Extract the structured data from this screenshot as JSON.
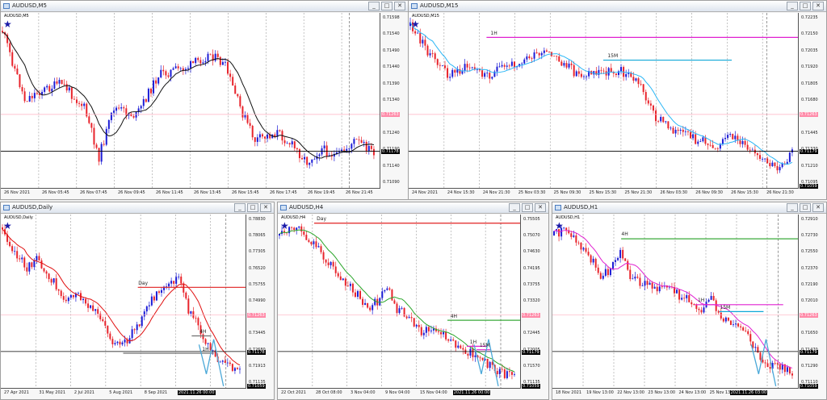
{
  "colors": {
    "bull": "#1b1bd6",
    "bear": "#e8232b",
    "ma_black": "#111111",
    "ma_cyan": "#29b6f6",
    "ma_red": "#e01010",
    "ma_green": "#2aa52a",
    "ma_magenta": "#e020d0",
    "level_red": "#e02020",
    "level_magenta": "#e020d0",
    "level_cyan": "#10a8d8",
    "level_green": "#3aaa3a",
    "level_grey": "#707070",
    "projection": "#4aa8d8",
    "hline_pink": "#ffb0c0"
  },
  "window_buttons": {
    "minimize": "_",
    "maximize": "□",
    "close": "✕"
  },
  "icons": {
    "window": "chart-window-icon",
    "indicator": "star-icon"
  },
  "windows": [
    {
      "title": "AUDUSD,M5",
      "symbol": "AUDUSD,M5",
      "kind": "m5",
      "seed": 11,
      "price_labels": [
        "0.71598",
        "0.71540",
        "0.71490",
        "0.71440",
        "0.71390",
        "0.71340",
        "0.71290",
        "0.71240",
        "0.71190",
        "0.71140",
        "0.71090"
      ],
      "bid": "0.71263",
      "last": "0.71178",
      "time_labels": [
        "26 Nov 2021",
        "26 Nov 05:45",
        "26 Nov 07:45",
        "26 Nov 09:45",
        "26 Nov 11:45",
        "26 Nov 13:45",
        "26 Nov 15:45",
        "26 Nov 17:45",
        "26 Nov 19:45",
        "26 Nov 21:45"
      ],
      "annotations": []
    },
    {
      "title": "AUDUSD,M15",
      "symbol": "AUDUSD,M15",
      "kind": "m15",
      "seed": 23,
      "price_labels": [
        "0.72235",
        "0.72150",
        "0.72035",
        "0.71920",
        "0.71805",
        "0.71680",
        "0.71565",
        "0.71445",
        "0.71330",
        "0.71210",
        "0.71095"
      ],
      "bid": "0.71263",
      "last": "0.71179",
      "extra_label": "0.71059",
      "time_labels": [
        "24 Nov 2021",
        "24 Nov 15:30",
        "24 Nov 21:30",
        "25 Nov 03:30",
        "25 Nov 09:30",
        "25 Nov 15:30",
        "25 Nov 21:30",
        "26 Nov 03:30",
        "26 Nov 09:30",
        "26 Nov 15:30",
        "26 Nov 21:30"
      ],
      "annotations": [
        "1H",
        "15M"
      ]
    },
    {
      "title": "AUDUSD,Daily",
      "symbol": "AUDUSD,Daily",
      "kind": "daily",
      "seed": 37,
      "price_labels": [
        "0.78830",
        "0.78065",
        "0.77305",
        "0.76520",
        "0.75755",
        "0.74990",
        "0.74225",
        "0.73445",
        "0.72680",
        "0.71913",
        "0.71135"
      ],
      "bid": "0.71263",
      "last": "0.71178",
      "extra_label": "0.71059",
      "time_labels": [
        "27 Apr 2021",
        "31 May 2021",
        "2 Jul 2021",
        "5 Aug 2021",
        "8 Sep 2021",
        "12 Oct 2021",
        "2021.11.26 00:00"
      ],
      "annotations": [
        "Day",
        "4H",
        "1H"
      ]
    },
    {
      "title": "AUDUSD,H4",
      "symbol": "AUDUSD,H4",
      "kind": "h4",
      "seed": 53,
      "price_labels": [
        "0.75505",
        "0.75070",
        "0.74630",
        "0.74195",
        "0.73755",
        "0.73320",
        "0.72880",
        "0.72445",
        "0.72005",
        "0.71570",
        "0.71135"
      ],
      "bid": "0.71263",
      "last": "0.71179",
      "extra_label": "0.71059",
      "time_labels": [
        "22 Oct 2021",
        "28 Oct 08:00",
        "3 Nov 04:00",
        "9 Nov 04:00",
        "15 Nov 04:00",
        "19 Nov 04:00",
        "2021.11.26 00:00"
      ],
      "annotations": [
        "Day",
        "4H",
        "1H",
        "15M"
      ]
    },
    {
      "title": "AUDUSD,H1",
      "symbol": "AUDUSD,H1",
      "kind": "h1",
      "seed": 71,
      "price_labels": [
        "0.72910",
        "0.72730",
        "0.72550",
        "0.72370",
        "0.72190",
        "0.72010",
        "0.71830",
        "0.71650",
        "0.71470",
        "0.71290",
        "0.71110"
      ],
      "bid": "0.71263",
      "last": "0.71179",
      "extra_label": "0.71059",
      "time_labels": [
        "18 Nov 2021",
        "19 Nov 13:00",
        "22 Nov 13:00",
        "23 Nov 13:00",
        "24 Nov 13:00",
        "25 Nov 13:00",
        "26 Nov 13:00",
        "2021.11.26 03:00"
      ],
      "annotations": [
        "4H",
        "1H",
        "15M"
      ]
    }
  ]
}
